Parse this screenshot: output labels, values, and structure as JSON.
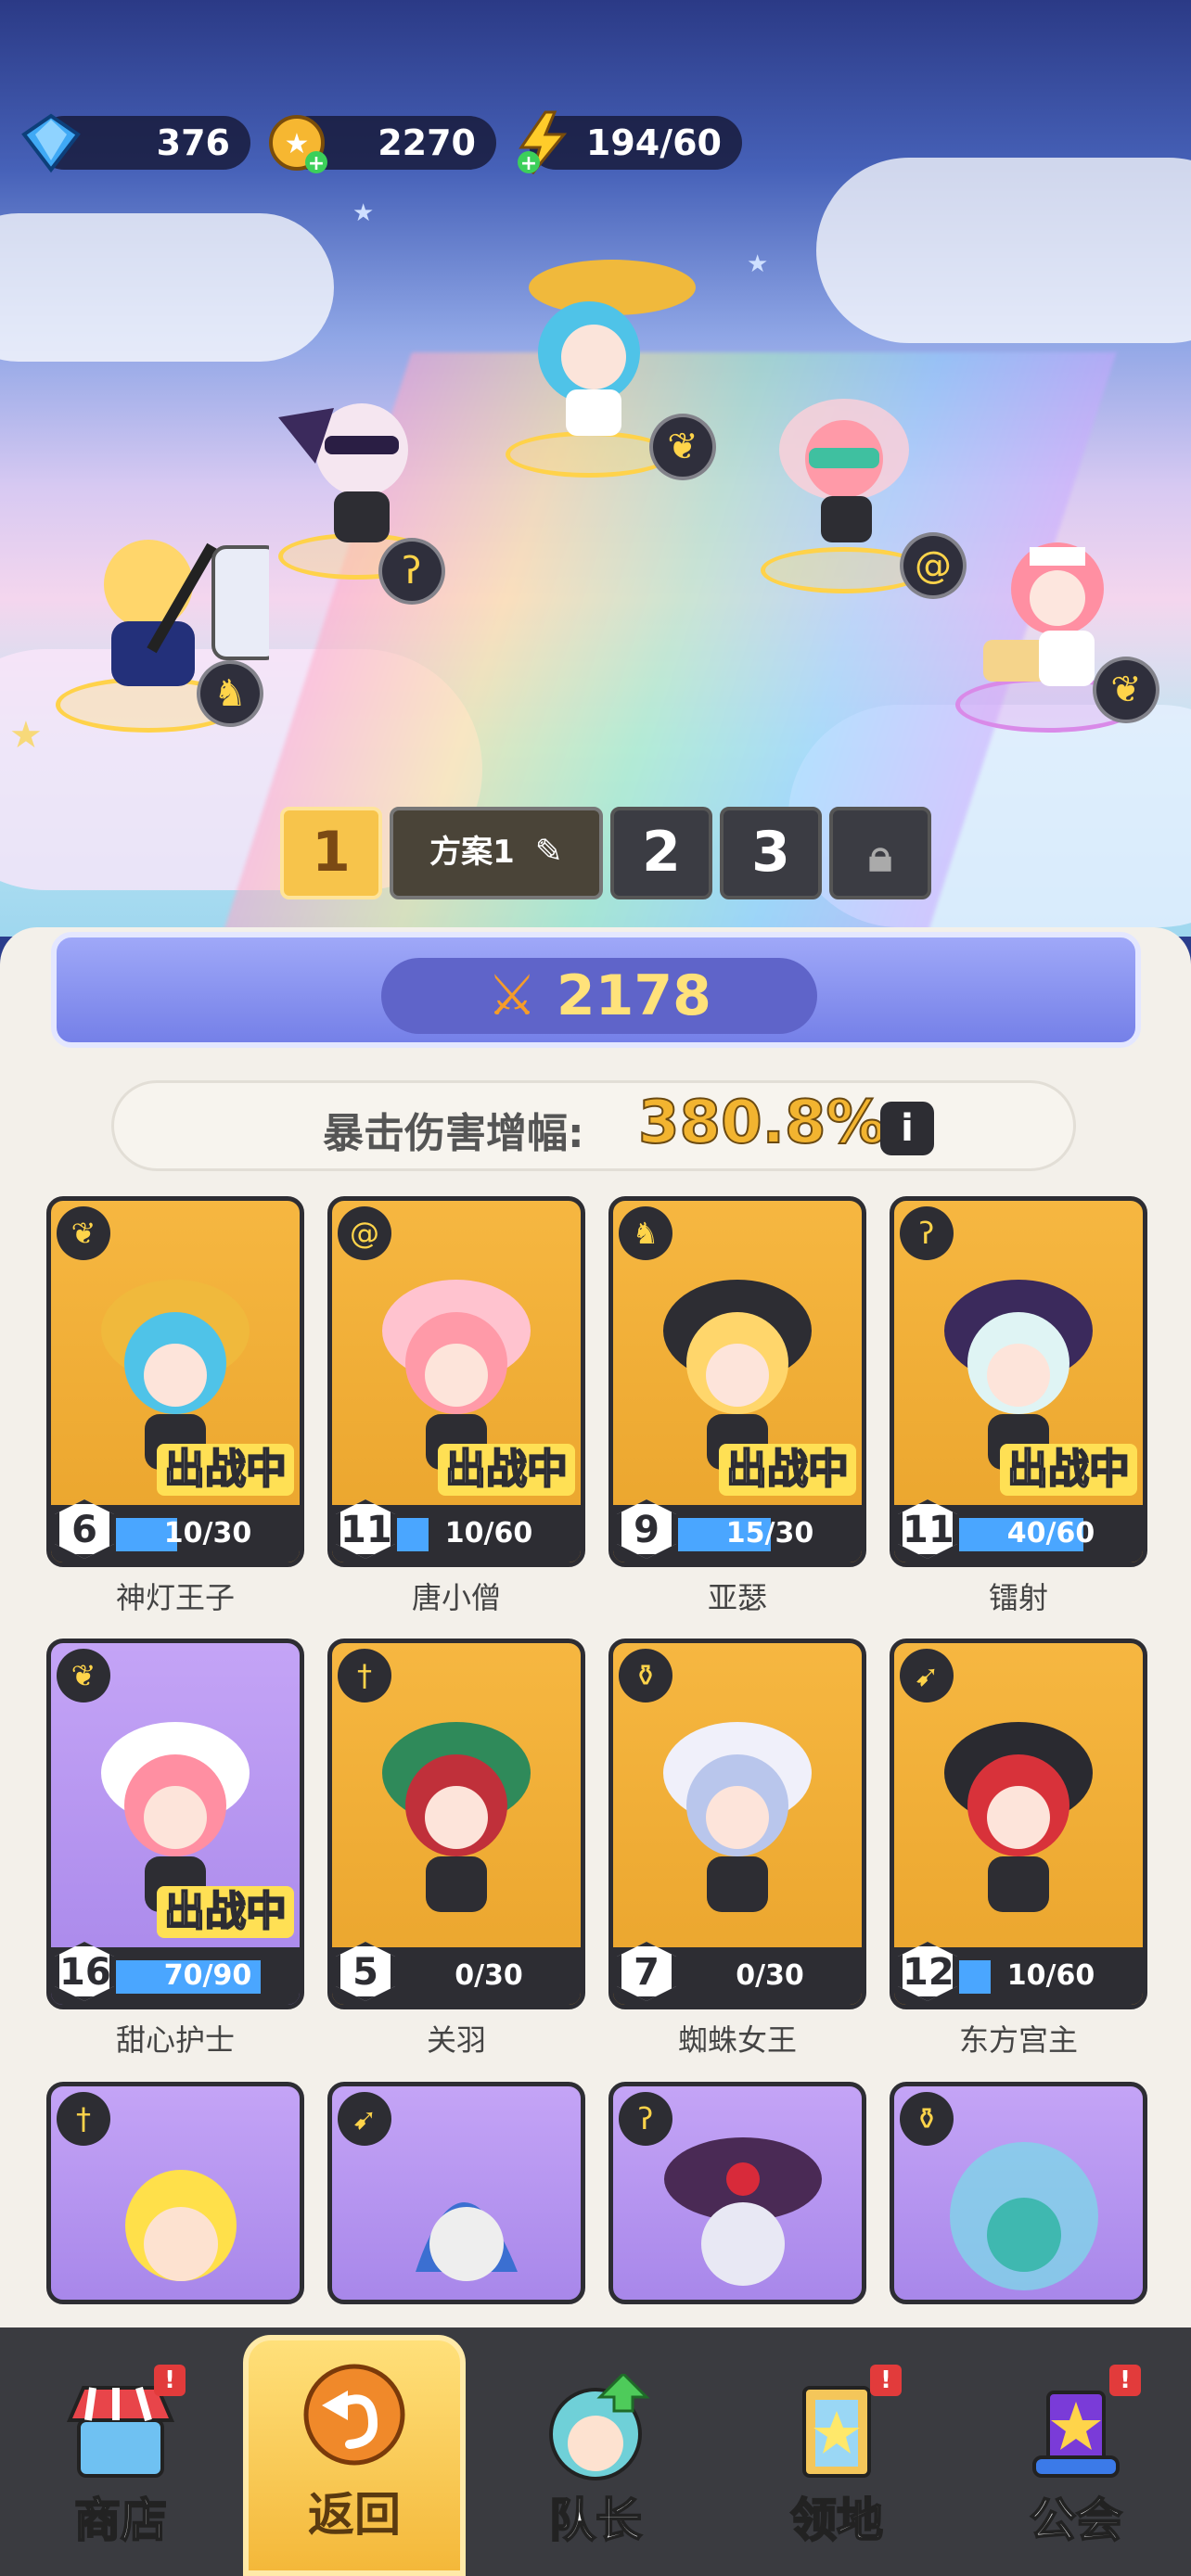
{
  "resources": {
    "gems": "376",
    "coins": "2270",
    "energy": "194/60"
  },
  "team_tabs": {
    "tab1": "1",
    "plan_name": "方案1",
    "tab2": "2",
    "tab3": "3"
  },
  "power": "2178",
  "crit": {
    "label": "暴击伤害增幅:",
    "value": "380.8%",
    "info": "i"
  },
  "deploy_label": "出战中",
  "heroes": [
    {
      "name": "神灯王子",
      "level": "6",
      "progress": "10/30",
      "fraction": 0.33,
      "class_icon": "wings-icon",
      "deployed": true
    },
    {
      "name": "唐小僧",
      "level": "11",
      "progress": "10/60",
      "fraction": 0.17,
      "class_icon": "spiral-icon",
      "deployed": true
    },
    {
      "name": "亚瑟",
      "level": "9",
      "progress": "15/30",
      "fraction": 0.5,
      "class_icon": "horned-helmet-icon",
      "deployed": true
    },
    {
      "name": "镭射",
      "level": "11",
      "progress": "40/60",
      "fraction": 0.67,
      "class_icon": "hook-icon",
      "deployed": true
    },
    {
      "name": "甜心护士",
      "level": "16",
      "progress": "70/90",
      "fraction": 0.78,
      "class_icon": "wings-icon",
      "deployed": true
    },
    {
      "name": "关羽",
      "level": "5",
      "progress": "0/30",
      "fraction": 0,
      "class_icon": "sword-icon",
      "deployed": false
    },
    {
      "name": "蜘蛛女王",
      "level": "7",
      "progress": "0/30",
      "fraction": 0,
      "class_icon": "potion-icon",
      "deployed": false
    },
    {
      "name": "东方宫主",
      "level": "12",
      "progress": "10/60",
      "fraction": 0.17,
      "class_icon": "bow-icon",
      "deployed": false
    }
  ],
  "nav": {
    "shop": "商店",
    "back": "返回",
    "captain": "队长",
    "territory": "领地",
    "guild": "公会",
    "badge": "!"
  },
  "colors": {
    "gold_card": "#f6b741",
    "purple_card": "#c4a4f6",
    "progress": "#4aa6ff",
    "dark": "#2d2d33"
  }
}
